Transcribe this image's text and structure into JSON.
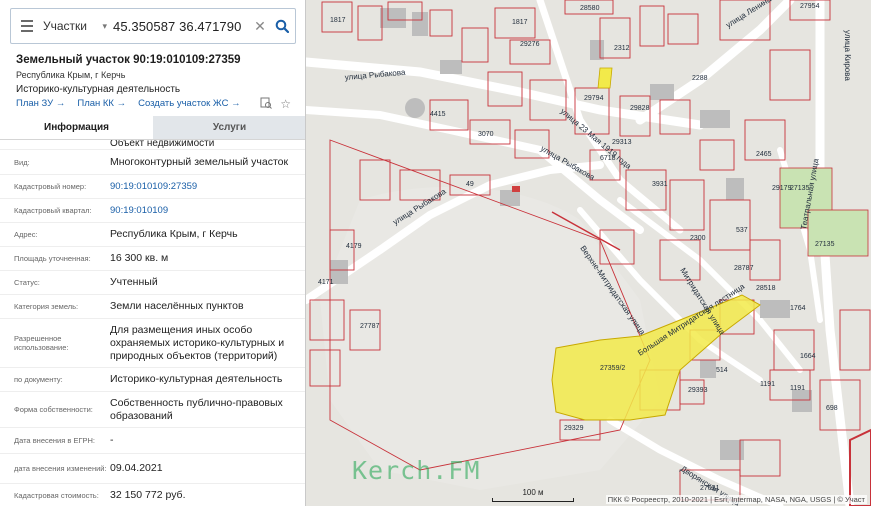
{
  "search": {
    "category": "Участки",
    "query": "45.350587 36.471790",
    "clear_icon": "close-icon",
    "search_icon": "search-icon"
  },
  "card": {
    "title": "Земельный участок 90:19:010109:27359",
    "region": "Республика Крым, г Керчь",
    "purpose": "Историко-культурная деятельность",
    "links": [
      "План ЗУ →",
      "План КК →",
      "Создать участок ЖС →"
    ]
  },
  "tabs": [
    {
      "label": "Информация",
      "active": true
    },
    {
      "label": "Услуги",
      "active": false
    }
  ],
  "partial_row": {
    "value": "Объект недвижимости"
  },
  "rows": [
    {
      "key": "Вид:",
      "value": "Многоконтурный земельный участок"
    },
    {
      "key": "Кадастровый номер:",
      "value": "90:19:010109:27359",
      "link": true
    },
    {
      "key": "Кадастровый квартал:",
      "value": "90:19:010109",
      "link": true
    },
    {
      "key": "Адрес:",
      "value": "Республика Крым, г Керчь"
    },
    {
      "key": "Площадь уточненная:",
      "value": "16 300 кв. м"
    },
    {
      "key": "Статус:",
      "value": "Учтенный"
    },
    {
      "key": "Категория земель:",
      "value": "Земли населённых пунктов"
    },
    {
      "key": "Разрешенное использование:",
      "value": "Для размещения иных особо охраняемых историко-культурных и природных объектов (территорий)"
    },
    {
      "key": "по документу:",
      "value": "Историко-культурная деятельность"
    },
    {
      "key": "Форма собственности:",
      "value": "Собственность публично-правовых образований"
    },
    {
      "key": "Дата внесения в ЕГРН:",
      "value": "-"
    },
    {
      "key": "дата внесения изменений:",
      "value": "09.04.2021"
    },
    {
      "key": "Кадастровая стоимость:",
      "value": "32 150 772 руб."
    }
  ],
  "map": {
    "streets": [
      "улица Рыбакова",
      "улица Рыбакова",
      "улица 23 Мая 1919 года",
      "улица Ленина",
      "улица Кирова",
      "Театральная улица",
      "Большая Митридатская лестница",
      "Митридатская улица",
      "Верхне-Митридатская улица",
      "Дворянская улица",
      "улица Рыбакова"
    ],
    "parcel_labels": [
      "1817",
      "29276",
      "28580",
      "27954",
      "2312",
      "27135",
      "2465",
      "29313",
      "27135",
      "1664",
      "1191",
      "698",
      "29329",
      "27031",
      "1764",
      "537",
      "3931",
      "4179",
      "2288",
      "29179",
      "4415",
      "3070",
      "29794",
      "6718",
      "29828",
      "1817",
      "27787",
      "2300",
      "28787",
      "28518",
      "29393",
      "514",
      "4171",
      "1191",
      "49",
      "27359/2"
    ],
    "highlight_label": "27359/2",
    "scale_label": "100 м",
    "credit": "ПКК © Росреестр, 2010-2021 | Esri, Intermap, NASA, NGA, USGS | © Участ",
    "watermark": "Kerch.FM",
    "colors": {
      "parcel": "#c8323a",
      "highlight": "#f2ea4a",
      "park": "#c9e3b3",
      "road": "#ffffff",
      "building": "#bdbdbd"
    }
  }
}
